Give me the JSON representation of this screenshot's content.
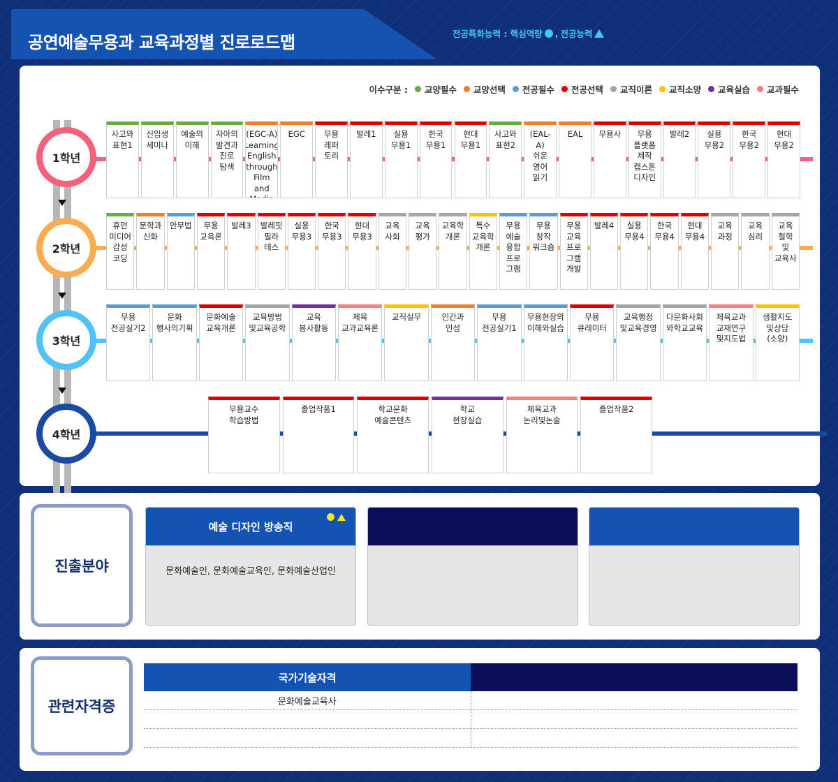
{
  "title": "공연예술무용과 교육과정별 진로로드맵",
  "competency": {
    "label": "전공특화능력 : 핵심역량",
    "separator": ",",
    "major_label": "전공능력"
  },
  "legend_label": "이수구분 :",
  "legend": [
    {
      "label": "교양필수",
      "color": "#6aaa45"
    },
    {
      "label": "교양선택",
      "color": "#ee7f31"
    },
    {
      "label": "전공필수",
      "color": "#5b9bd5"
    },
    {
      "label": "전공선택",
      "color": "#e00000"
    },
    {
      "label": "교직이론",
      "color": "#a5a5a5"
    },
    {
      "label": "교직소양",
      "color": "#ffc000"
    },
    {
      "label": "교육실습",
      "color": "#7030a0"
    },
    {
      "label": "교과필수",
      "color": "#f47f7f"
    }
  ],
  "years": [
    {
      "label": "1학년",
      "color": "#f4607d",
      "courses": [
        {
          "lines": [
            "사고와",
            "표현1"
          ],
          "type": "교양필수"
        },
        {
          "lines": [
            "신입생",
            "세미나"
          ],
          "type": "교양필수"
        },
        {
          "lines": [
            "예술의",
            "이해"
          ],
          "type": "교양필수"
        },
        {
          "lines": [
            "자아의",
            "발견과",
            "진로",
            "탐색"
          ],
          "type": "교양필수"
        },
        {
          "lines": [
            "(EGC-A)",
            "Learning",
            "English",
            "through",
            "Film",
            "and",
            "Media"
          ],
          "type": "교양선택"
        },
        {
          "lines": [
            "EGC"
          ],
          "type": "교양선택"
        },
        {
          "lines": [
            "무용",
            "레퍼",
            "토리"
          ],
          "type": "전공선택"
        },
        {
          "lines": [
            "발레1"
          ],
          "type": "전공선택"
        },
        {
          "lines": [
            "실용",
            "무용1"
          ],
          "type": "전공선택"
        },
        {
          "lines": [
            "한국",
            "무용1"
          ],
          "type": "전공선택"
        },
        {
          "lines": [
            "현대",
            "무용1"
          ],
          "type": "전공선택"
        },
        {
          "lines": [
            "사고와",
            "표현2"
          ],
          "type": "교양필수"
        },
        {
          "lines": [
            "(EAL-A)",
            "쉬운",
            "영어",
            "읽기"
          ],
          "type": "교양선택"
        },
        {
          "lines": [
            "EAL"
          ],
          "type": "교양선택"
        },
        {
          "lines": [
            "무용사"
          ],
          "type": "전공선택"
        },
        {
          "lines": [
            "무용",
            "플랫폼",
            "제작",
            "캡스톤",
            "디자인"
          ],
          "type": "전공선택"
        },
        {
          "lines": [
            "발레2"
          ],
          "type": "전공선택"
        },
        {
          "lines": [
            "실용",
            "무용2"
          ],
          "type": "전공선택"
        },
        {
          "lines": [
            "한국",
            "무용2"
          ],
          "type": "전공선택"
        },
        {
          "lines": [
            "현대",
            "무용2"
          ],
          "type": "전공선택"
        }
      ]
    },
    {
      "label": "2학년",
      "color": "#fbac50",
      "courses": [
        {
          "lines": [
            "휴먼",
            "미디어",
            "감성",
            "코딩"
          ],
          "type": "교양필수"
        },
        {
          "lines": [
            "문학과",
            "신화"
          ],
          "type": "교양선택"
        },
        {
          "lines": [
            "안무법"
          ],
          "type": "전공필수"
        },
        {
          "lines": [
            "무용",
            "교육론"
          ],
          "type": "전공선택"
        },
        {
          "lines": [
            "발레3"
          ],
          "type": "전공선택"
        },
        {
          "lines": [
            "발레핏",
            "필라",
            "테스"
          ],
          "type": "전공선택"
        },
        {
          "lines": [
            "실용",
            "무용3"
          ],
          "type": "전공선택"
        },
        {
          "lines": [
            "한국",
            "무용3"
          ],
          "type": "전공선택"
        },
        {
          "lines": [
            "현대",
            "무용3"
          ],
          "type": "전공선택"
        },
        {
          "lines": [
            "교육",
            "사회"
          ],
          "type": "교직이론"
        },
        {
          "lines": [
            "교육",
            "평가"
          ],
          "type": "교직이론"
        },
        {
          "lines": [
            "교육학",
            "개론"
          ],
          "type": "교직이론"
        },
        {
          "lines": [
            "특수",
            "교육학",
            "개론"
          ],
          "type": "교직소양"
        },
        {
          "lines": [
            "무용",
            "예술",
            "융합",
            "프로",
            "그램"
          ],
          "type": "전공필수"
        },
        {
          "lines": [
            "무용",
            "창작",
            "워크숍"
          ],
          "type": "전공필수"
        },
        {
          "lines": [
            "무용",
            "교육",
            "프로",
            "그램",
            "개발"
          ],
          "type": "전공선택"
        },
        {
          "lines": [
            "발레4"
          ],
          "type": "전공선택"
        },
        {
          "lines": [
            "실용",
            "무용4"
          ],
          "type": "전공선택"
        },
        {
          "lines": [
            "한국",
            "무용4"
          ],
          "type": "전공선택"
        },
        {
          "lines": [
            "현대",
            "무용4"
          ],
          "type": "전공선택"
        },
        {
          "lines": [
            "교육",
            "과정"
          ],
          "type": "교직이론"
        },
        {
          "lines": [
            "교육",
            "심리"
          ],
          "type": "교직이론"
        },
        {
          "lines": [
            "교육",
            "철학",
            "및",
            "교육사"
          ],
          "type": "교직이론"
        }
      ]
    },
    {
      "label": "3학년",
      "color": "#4fc3f7",
      "courses": [
        {
          "lines": [
            "무용",
            "전공실기2"
          ],
          "type": "전공필수"
        },
        {
          "lines": [
            "문화",
            "행사의기획"
          ],
          "type": "전공필수"
        },
        {
          "lines": [
            "문화예술",
            "교육개론"
          ],
          "type": "전공선택"
        },
        {
          "lines": [
            "교육방법",
            "및교육공학"
          ],
          "type": "교직이론"
        },
        {
          "lines": [
            "교육",
            "봉사활동"
          ],
          "type": "교육실습"
        },
        {
          "lines": [
            "체육",
            "교과교육론"
          ],
          "type": "교과필수"
        },
        {
          "lines": [
            "교직실무"
          ],
          "type": "교직소양"
        },
        {
          "lines": [
            "인간과",
            "인성"
          ],
          "type": "교양선택"
        },
        {
          "lines": [
            "무용",
            "전공실기1"
          ],
          "type": "전공필수"
        },
        {
          "lines": [
            "무용현장의",
            "이해와실습"
          ],
          "type": "전공필수"
        },
        {
          "lines": [
            "무용",
            "큐레이터"
          ],
          "type": "전공선택"
        },
        {
          "lines": [
            "교육행정",
            "및교육경영"
          ],
          "type": "교직이론"
        },
        {
          "lines": [
            "다문화사회",
            "와학교교육"
          ],
          "type": "교직이론"
        },
        {
          "lines": [
            "체육교과",
            "교재연구",
            "및지도법"
          ],
          "type": "교과필수"
        },
        {
          "lines": [
            "생활지도",
            "및상담",
            "(소양)"
          ],
          "type": "교직소양"
        }
      ]
    },
    {
      "label": "4학년",
      "color": "#1a4aa2",
      "courses": [
        {
          "lines": [
            "무용교수",
            "학습방법"
          ],
          "type": "전공선택"
        },
        {
          "lines": [
            "졸업작품1"
          ],
          "type": "전공선택"
        },
        {
          "lines": [
            "학교문화",
            "예술콘텐츠"
          ],
          "type": "전공선택"
        },
        {
          "lines": [
            "학교",
            "현장실습"
          ],
          "type": "교육실습"
        },
        {
          "lines": [
            "체육교과",
            "논리및논술"
          ],
          "type": "교과필수"
        },
        {
          "lines": [
            "졸업작품2"
          ],
          "type": "전공선택"
        }
      ]
    }
  ],
  "career": {
    "label": "진출분야",
    "boxes": [
      {
        "title": "예술 디자인 방송직",
        "body": "문화예술인, 문화예술교육인, 문화예술산업인",
        "header_color": "#1553b3",
        "marks": true
      },
      {
        "title": "",
        "body": "",
        "header_color": "#0c0e5a",
        "marks": false
      },
      {
        "title": "",
        "body": "",
        "header_color": "#1553b3",
        "marks": false
      }
    ]
  },
  "certs": {
    "label": "관련자격증",
    "headers": [
      "국가기술자격",
      ""
    ],
    "header_colors": [
      "#1553b3",
      "#0c0e5a"
    ],
    "rows": [
      [
        "문화예술교육사",
        ""
      ],
      [
        "",
        ""
      ],
      [
        "",
        ""
      ]
    ]
  }
}
